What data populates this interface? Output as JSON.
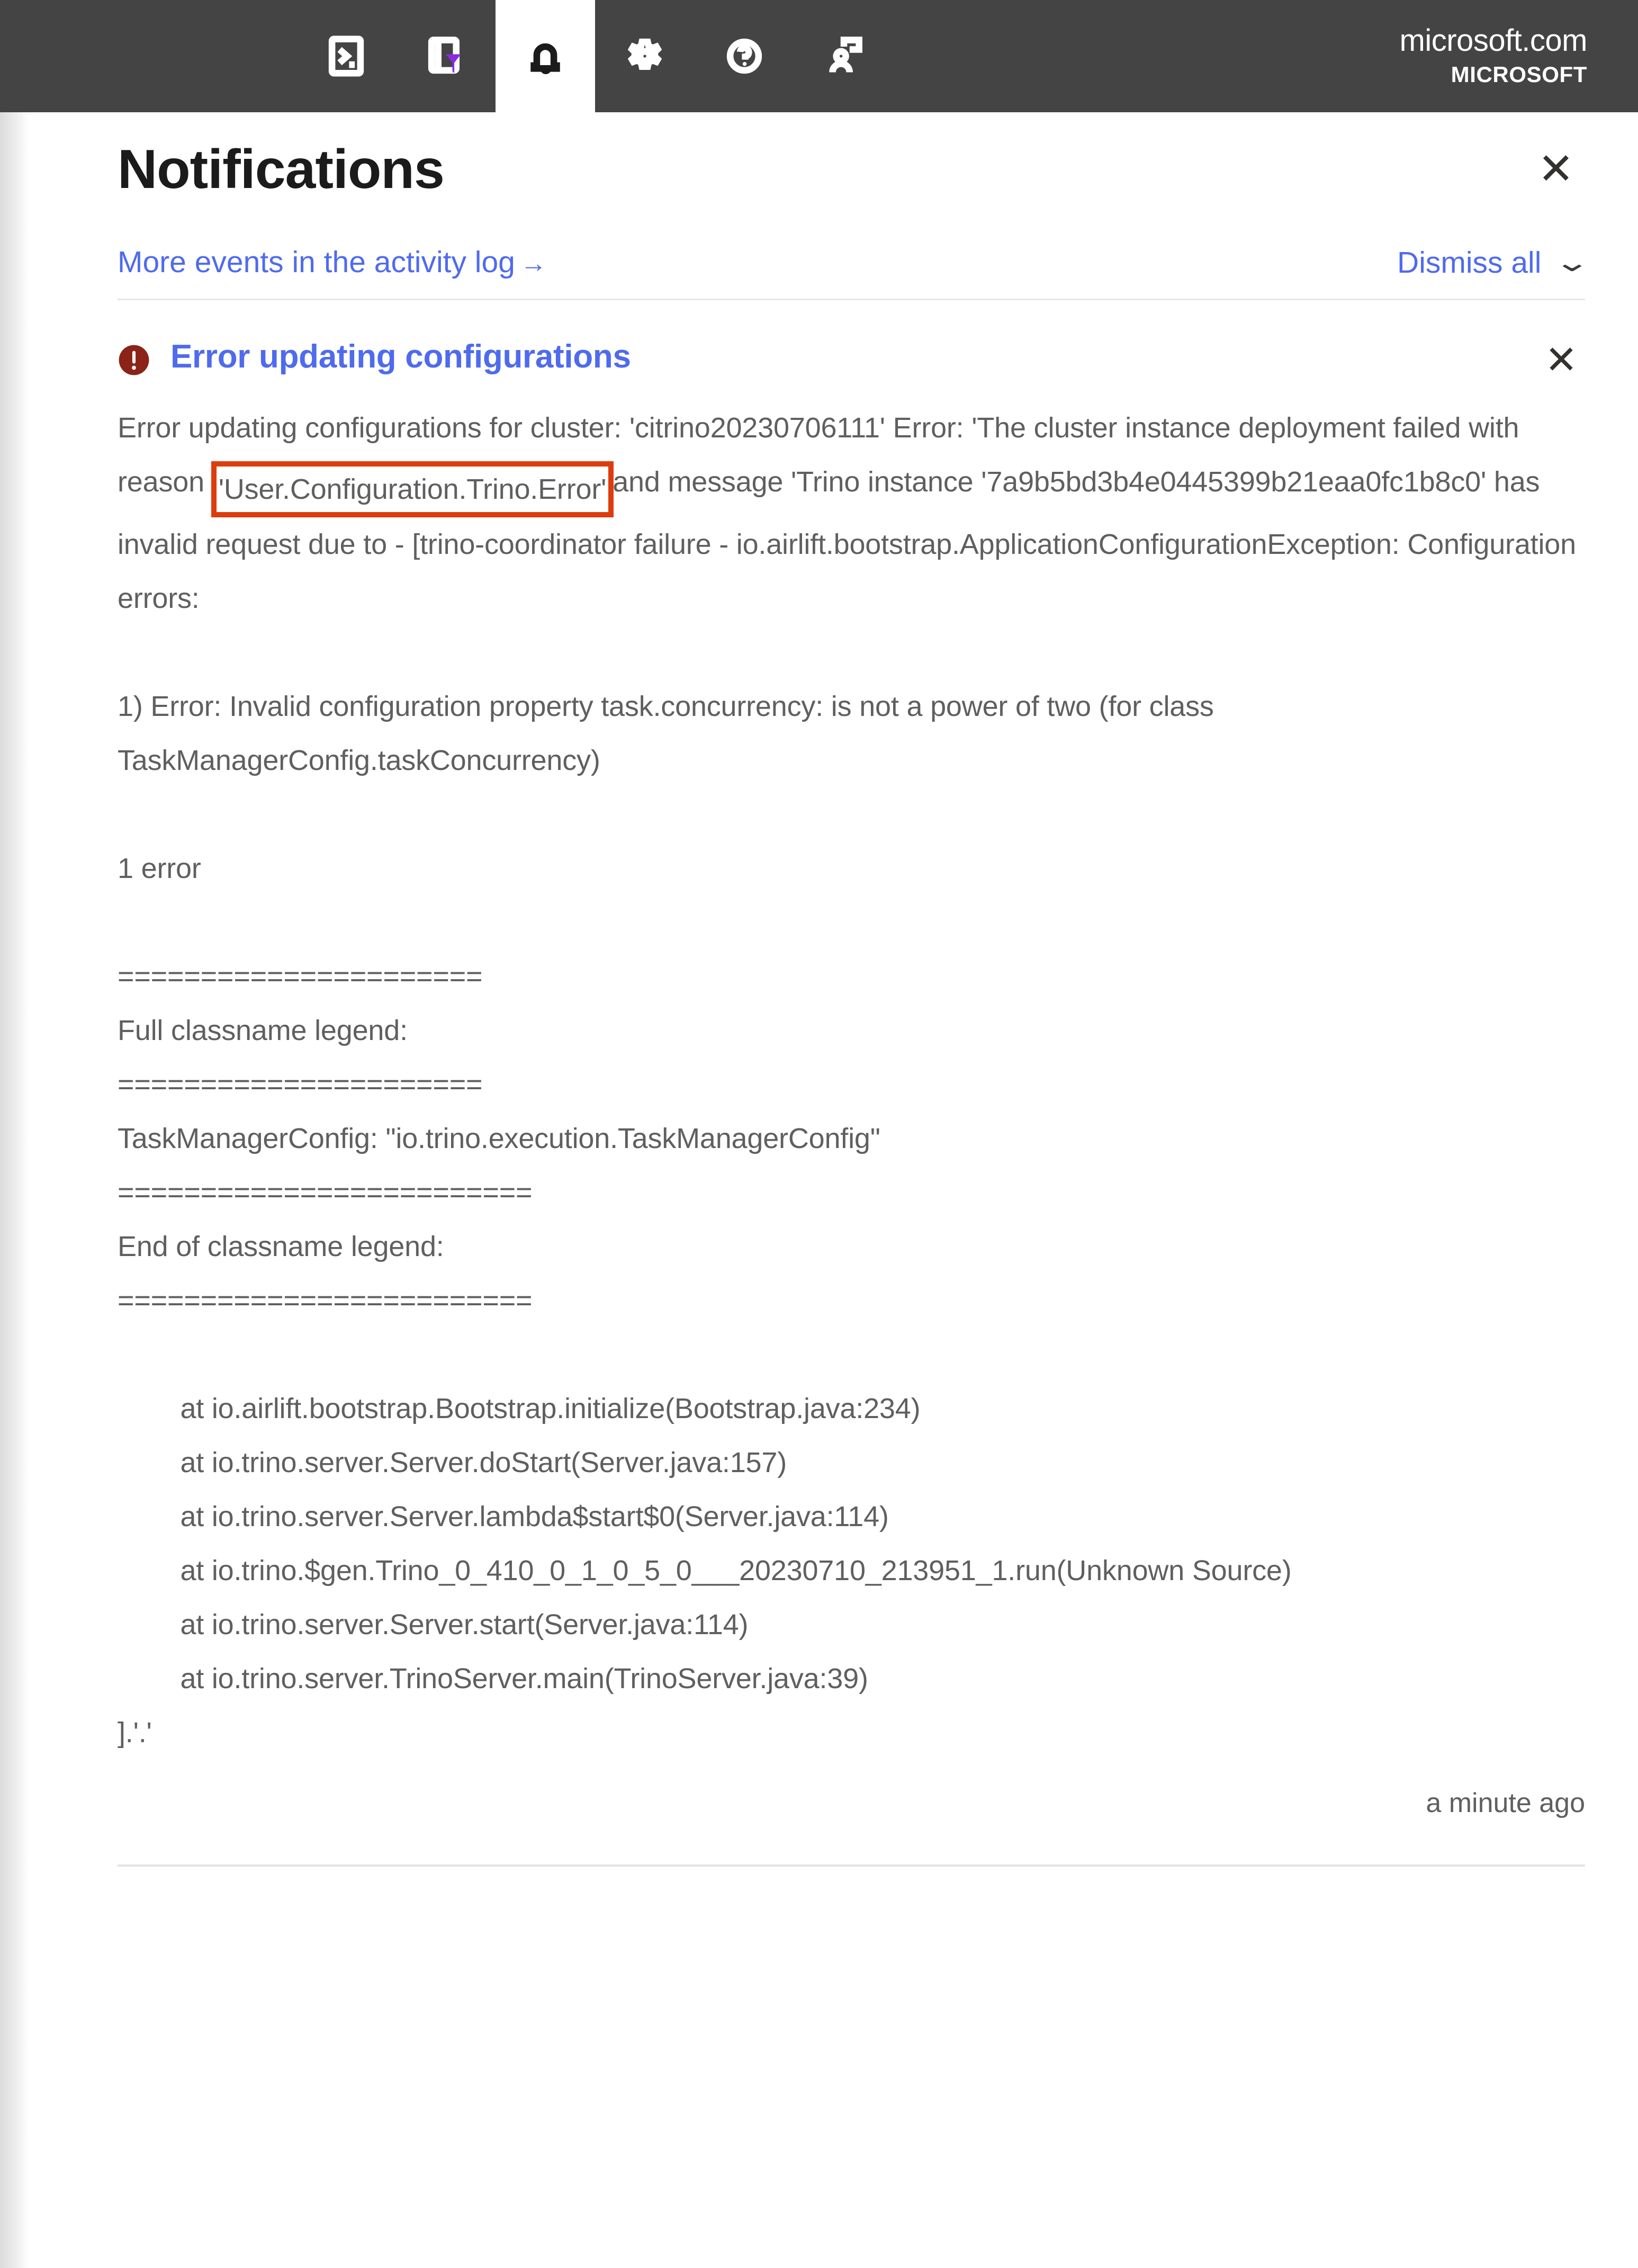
{
  "topbar": {
    "icons": [
      {
        "name": "cloud-shell-icon",
        "label": "Cloud Shell"
      },
      {
        "name": "directories-subscriptions-icon",
        "label": "Directories + subscriptions"
      },
      {
        "name": "notifications-bell-icon",
        "label": "Notifications",
        "active": true
      },
      {
        "name": "settings-gear-icon",
        "label": "Settings"
      },
      {
        "name": "help-question-icon",
        "label": "Help"
      },
      {
        "name": "feedback-person-icon",
        "label": "Feedback"
      }
    ],
    "account": {
      "upn": "microsoft.com",
      "tenant": "MICROSOFT"
    }
  },
  "panel": {
    "title": "Notifications",
    "close_label": "✕",
    "toolbar": {
      "activity_log_link": "More events in the activity log",
      "activity_log_arrow": "→",
      "dismiss_all_label": "Dismiss all",
      "dismiss_all_chevron": "⌄"
    },
    "notification": {
      "severity": "error",
      "severity_color": "#8b2318",
      "title": "Error updating configurations",
      "close_label": "✕",
      "timestamp": "a minute ago",
      "highlight_color": "#dd3d0d",
      "body_parts": {
        "before_highlight": "Error updating configurations for cluster: 'citrino20230706111' Error: 'The cluster instance deployment failed with reason ",
        "highlight": "'User.Configuration.Trino.Error'",
        "after_highlight": "and message 'Trino instance '7a9b5bd3b4e0445399b21eaa0fc1b8c0' has invalid request due to - [trino-coordinator failure - io.airlift.bootstrap.ApplicationConfigurationException: Configuration errors:\n\n1) Error: Invalid configuration property task.concurrency: is not a power of two (for class TaskManagerConfig.taskConcurrency)\n\n1 error\n\n======================\nFull classname legend:\n======================\nTaskManagerConfig: \"io.trino.execution.TaskManagerConfig\"\n=========================\nEnd of classname legend:\n=========================\n\n\tat io.airlift.bootstrap.Bootstrap.initialize(Bootstrap.java:234)\n\tat io.trino.server.Server.doStart(Server.java:157)\n\tat io.trino.server.Server.lambda$start$0(Server.java:114)\n\tat io.trino.$gen.Trino_0_410_0_1_0_5_0___20230710_213951_1.run(Unknown Source)\n\tat io.trino.server.Server.start(Server.java:114)\n\tat io.trino.server.TrinoServer.main(TrinoServer.java:39)\n].'.'"
      }
    }
  }
}
